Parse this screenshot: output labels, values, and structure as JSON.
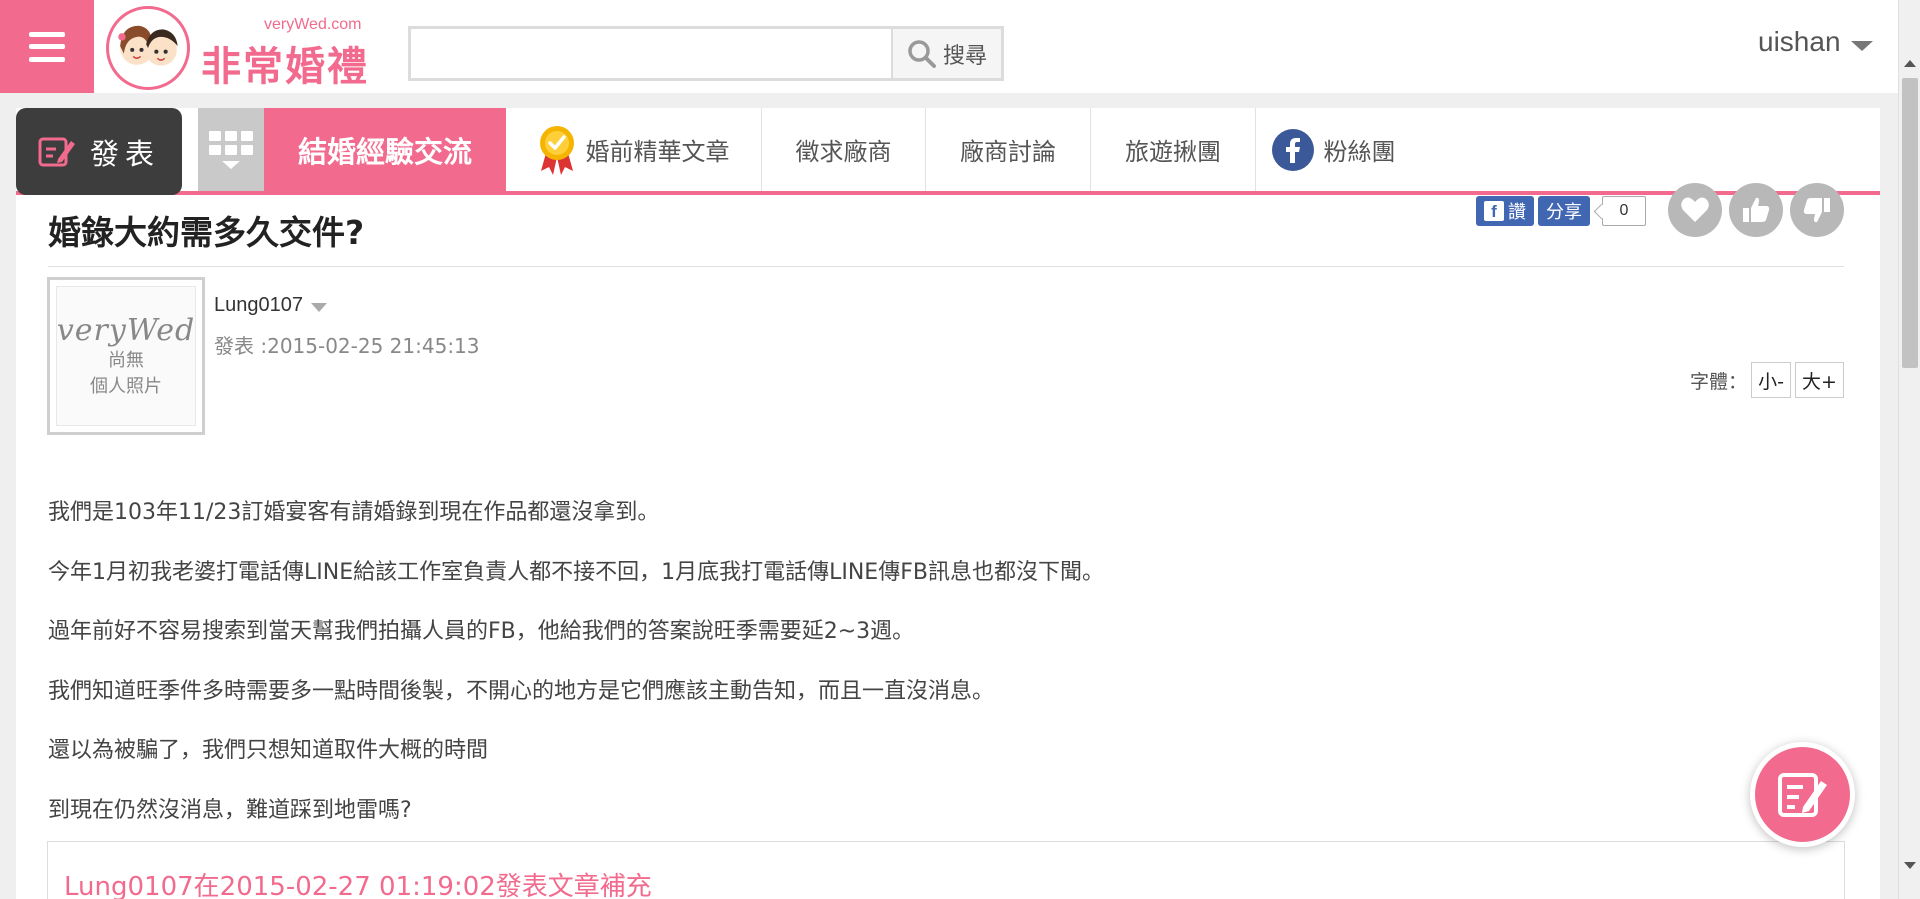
{
  "header": {
    "brand_url": "veryWed.com",
    "brand_name": "非常婚禮",
    "search_placeholder": "",
    "search_button": "搜尋",
    "username": "uishan"
  },
  "nav": {
    "post_button": "發表",
    "tabs": [
      {
        "label": "結婚經驗交流",
        "active": true
      },
      {
        "label": "婚前精華文章",
        "icon": "medal-icon"
      },
      {
        "label": "徵求廠商"
      },
      {
        "label": "廠商討論"
      },
      {
        "label": "旅遊揪團"
      },
      {
        "label": "粉絲團",
        "icon": "facebook-icon"
      }
    ]
  },
  "post": {
    "title": "婚錄大約需多久交件?",
    "share": {
      "like_label": "讚",
      "share_label": "分享",
      "count": "0"
    },
    "author": "Lung0107",
    "posted": "發表 :2015-02-25 21:45:13",
    "photo_placeholder": {
      "watermark": "veryWed",
      "line1": "尚無",
      "line2": "個人照片"
    },
    "font_size": {
      "label": "字體：",
      "small": "小-",
      "large": "大+"
    },
    "paragraphs": [
      "我們是103年11/23訂婚宴客有請婚錄到現在作品都還沒拿到。",
      "今年1月初我老婆打電話傳LINE給該工作室負責人都不接不回，1月底我打電話傳LINE傳FB訊息也都沒下聞。",
      "過年前好不容易搜索到當天幫我們拍攝人員的FB，他給我們的答案說旺季需要延2~3週。",
      "我們知道旺季件多時需要多一點時間後製，不開心的地方是它們應該主動告知，而且一直沒消息。",
      "還以為被騙了，我們只想知道取件大概的時間",
      "到現在仍然沒消息，難道踩到地雷嗎?"
    ],
    "supplement_title": "Lung0107在2015-02-27 01:19:02發表文章補充"
  },
  "colors": {
    "accent": "#f26b8e",
    "dark": "#3d3d3d",
    "facebook": "#4267b2"
  }
}
